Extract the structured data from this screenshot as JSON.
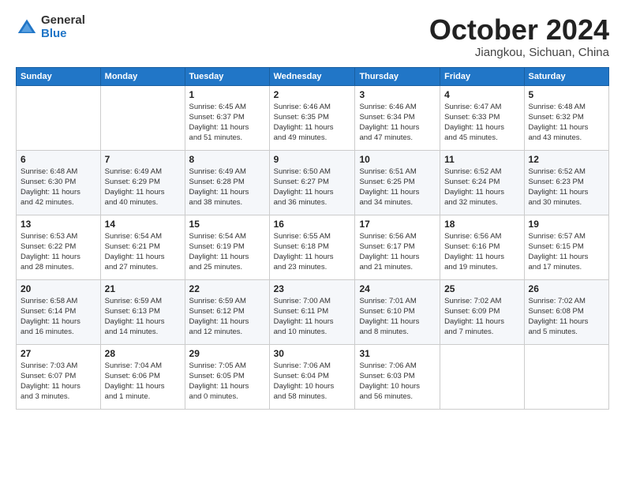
{
  "logo": {
    "general": "General",
    "blue": "Blue"
  },
  "title": "October 2024",
  "subtitle": "Jiangkou, Sichuan, China",
  "days_header": [
    "Sunday",
    "Monday",
    "Tuesday",
    "Wednesday",
    "Thursday",
    "Friday",
    "Saturday"
  ],
  "weeks": [
    [
      {
        "day": "",
        "info": ""
      },
      {
        "day": "",
        "info": ""
      },
      {
        "day": "1",
        "info": "Sunrise: 6:45 AM\nSunset: 6:37 PM\nDaylight: 11 hours\nand 51 minutes."
      },
      {
        "day": "2",
        "info": "Sunrise: 6:46 AM\nSunset: 6:35 PM\nDaylight: 11 hours\nand 49 minutes."
      },
      {
        "day": "3",
        "info": "Sunrise: 6:46 AM\nSunset: 6:34 PM\nDaylight: 11 hours\nand 47 minutes."
      },
      {
        "day": "4",
        "info": "Sunrise: 6:47 AM\nSunset: 6:33 PM\nDaylight: 11 hours\nand 45 minutes."
      },
      {
        "day": "5",
        "info": "Sunrise: 6:48 AM\nSunset: 6:32 PM\nDaylight: 11 hours\nand 43 minutes."
      }
    ],
    [
      {
        "day": "6",
        "info": "Sunrise: 6:48 AM\nSunset: 6:30 PM\nDaylight: 11 hours\nand 42 minutes."
      },
      {
        "day": "7",
        "info": "Sunrise: 6:49 AM\nSunset: 6:29 PM\nDaylight: 11 hours\nand 40 minutes."
      },
      {
        "day": "8",
        "info": "Sunrise: 6:49 AM\nSunset: 6:28 PM\nDaylight: 11 hours\nand 38 minutes."
      },
      {
        "day": "9",
        "info": "Sunrise: 6:50 AM\nSunset: 6:27 PM\nDaylight: 11 hours\nand 36 minutes."
      },
      {
        "day": "10",
        "info": "Sunrise: 6:51 AM\nSunset: 6:25 PM\nDaylight: 11 hours\nand 34 minutes."
      },
      {
        "day": "11",
        "info": "Sunrise: 6:52 AM\nSunset: 6:24 PM\nDaylight: 11 hours\nand 32 minutes."
      },
      {
        "day": "12",
        "info": "Sunrise: 6:52 AM\nSunset: 6:23 PM\nDaylight: 11 hours\nand 30 minutes."
      }
    ],
    [
      {
        "day": "13",
        "info": "Sunrise: 6:53 AM\nSunset: 6:22 PM\nDaylight: 11 hours\nand 28 minutes."
      },
      {
        "day": "14",
        "info": "Sunrise: 6:54 AM\nSunset: 6:21 PM\nDaylight: 11 hours\nand 27 minutes."
      },
      {
        "day": "15",
        "info": "Sunrise: 6:54 AM\nSunset: 6:19 PM\nDaylight: 11 hours\nand 25 minutes."
      },
      {
        "day": "16",
        "info": "Sunrise: 6:55 AM\nSunset: 6:18 PM\nDaylight: 11 hours\nand 23 minutes."
      },
      {
        "day": "17",
        "info": "Sunrise: 6:56 AM\nSunset: 6:17 PM\nDaylight: 11 hours\nand 21 minutes."
      },
      {
        "day": "18",
        "info": "Sunrise: 6:56 AM\nSunset: 6:16 PM\nDaylight: 11 hours\nand 19 minutes."
      },
      {
        "day": "19",
        "info": "Sunrise: 6:57 AM\nSunset: 6:15 PM\nDaylight: 11 hours\nand 17 minutes."
      }
    ],
    [
      {
        "day": "20",
        "info": "Sunrise: 6:58 AM\nSunset: 6:14 PM\nDaylight: 11 hours\nand 16 minutes."
      },
      {
        "day": "21",
        "info": "Sunrise: 6:59 AM\nSunset: 6:13 PM\nDaylight: 11 hours\nand 14 minutes."
      },
      {
        "day": "22",
        "info": "Sunrise: 6:59 AM\nSunset: 6:12 PM\nDaylight: 11 hours\nand 12 minutes."
      },
      {
        "day": "23",
        "info": "Sunrise: 7:00 AM\nSunset: 6:11 PM\nDaylight: 11 hours\nand 10 minutes."
      },
      {
        "day": "24",
        "info": "Sunrise: 7:01 AM\nSunset: 6:10 PM\nDaylight: 11 hours\nand 8 minutes."
      },
      {
        "day": "25",
        "info": "Sunrise: 7:02 AM\nSunset: 6:09 PM\nDaylight: 11 hours\nand 7 minutes."
      },
      {
        "day": "26",
        "info": "Sunrise: 7:02 AM\nSunset: 6:08 PM\nDaylight: 11 hours\nand 5 minutes."
      }
    ],
    [
      {
        "day": "27",
        "info": "Sunrise: 7:03 AM\nSunset: 6:07 PM\nDaylight: 11 hours\nand 3 minutes."
      },
      {
        "day": "28",
        "info": "Sunrise: 7:04 AM\nSunset: 6:06 PM\nDaylight: 11 hours\nand 1 minute."
      },
      {
        "day": "29",
        "info": "Sunrise: 7:05 AM\nSunset: 6:05 PM\nDaylight: 11 hours\nand 0 minutes."
      },
      {
        "day": "30",
        "info": "Sunrise: 7:06 AM\nSunset: 6:04 PM\nDaylight: 10 hours\nand 58 minutes."
      },
      {
        "day": "31",
        "info": "Sunrise: 7:06 AM\nSunset: 6:03 PM\nDaylight: 10 hours\nand 56 minutes."
      },
      {
        "day": "",
        "info": ""
      },
      {
        "day": "",
        "info": ""
      }
    ]
  ]
}
